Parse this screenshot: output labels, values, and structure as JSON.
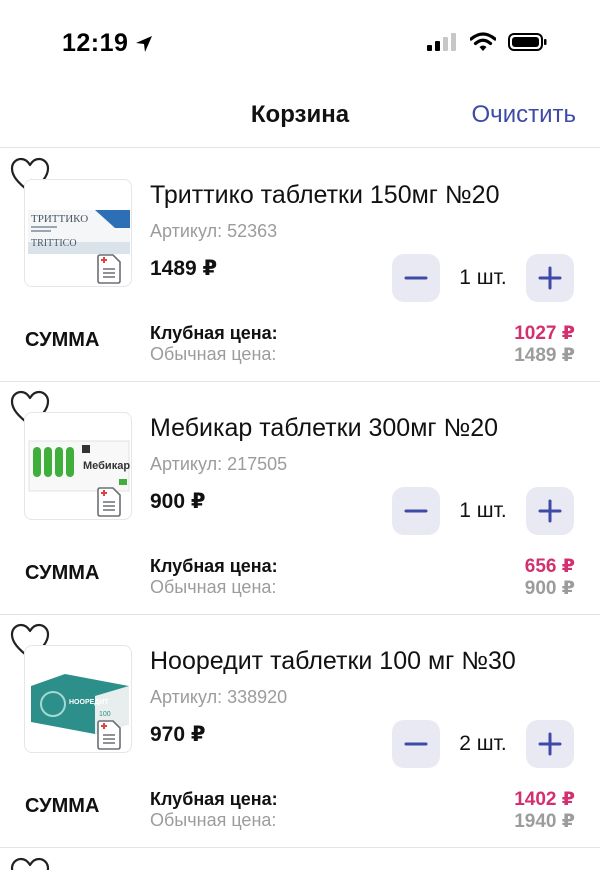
{
  "status_bar": {
    "time": "12:19"
  },
  "nav": {
    "title": "Корзина",
    "clear_label": "Очистить"
  },
  "labels": {
    "sum": "СУММА",
    "club_price": "Клубная цена:",
    "regular_price": "Обычная цена:"
  },
  "items": [
    {
      "name": "Триттико таблетки 150мг №20",
      "sku": "Артикул: 52363",
      "price": "1489 ₽",
      "quantity": "1 шт.",
      "club_price": "1027 ₽",
      "regular_price": "1489 ₽",
      "pack_text": "ТРИТТИКО"
    },
    {
      "name": "Мебикар таблетки 300мг №20",
      "sku": "Артикул: 217505",
      "price": "900 ₽",
      "quantity": "1 шт.",
      "club_price": "656 ₽",
      "regular_price": "900 ₽",
      "pack_text": "Мебикар"
    },
    {
      "name": "Нооредит таблетки 100 мг №30",
      "sku": "Артикул: 338920",
      "price": "970 ₽",
      "quantity": "2 шт.",
      "club_price": "1402 ₽",
      "regular_price": "1940 ₽",
      "pack_text": "НООРЕДИТ"
    }
  ],
  "icons": {
    "favorite": "heart-outline-icon",
    "prescription": "prescription-document-icon",
    "minus": "minus-icon",
    "plus": "plus-icon",
    "location": "location-arrow-icon",
    "signal": "cellular-signal-icon",
    "wifi": "wifi-icon",
    "battery": "battery-icon"
  },
  "colors": {
    "accent": "#3e4aa6",
    "club_price": "#d2306f",
    "muted": "#9c9c9c",
    "stepper_bg": "#e9e9f4"
  }
}
